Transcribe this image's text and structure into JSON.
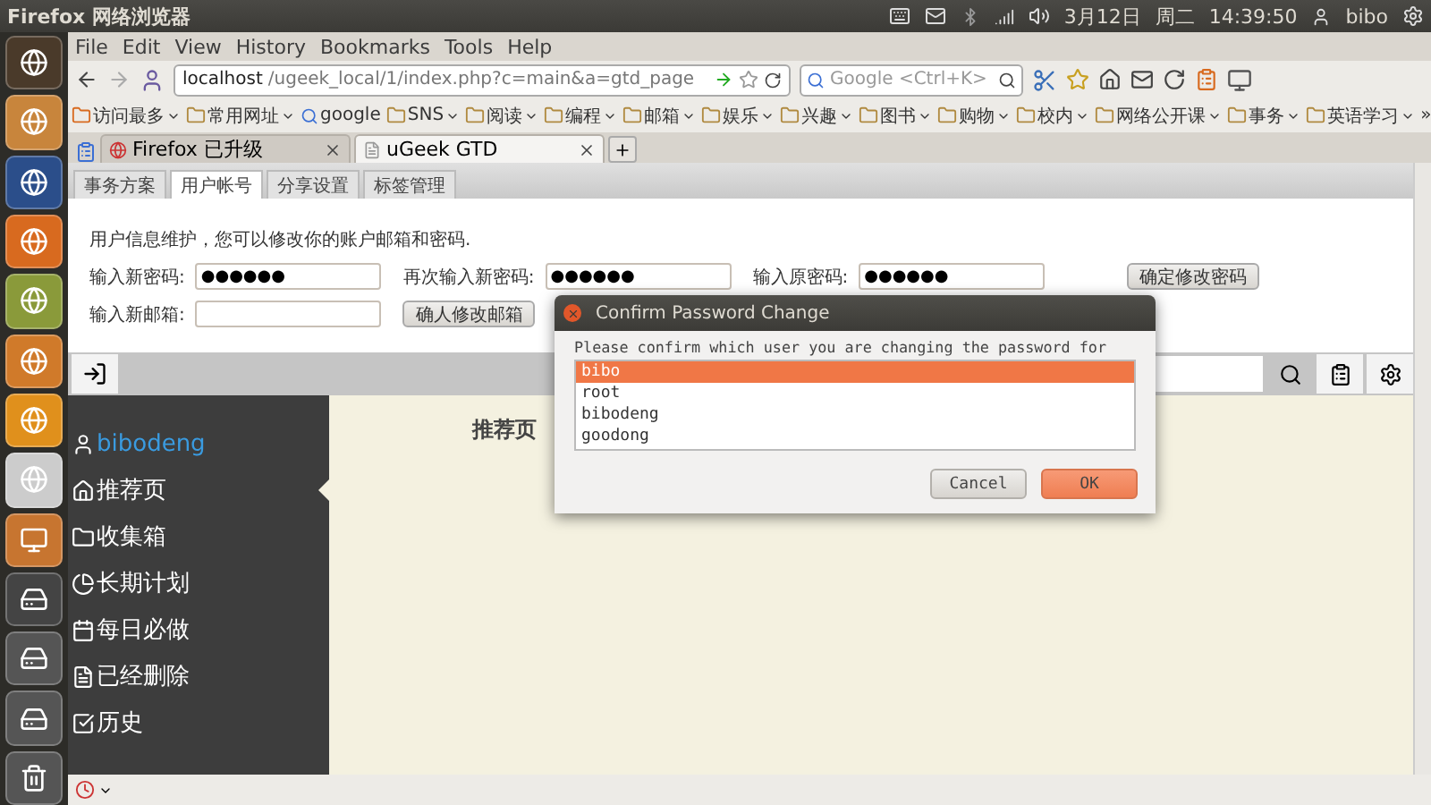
{
  "top_panel": {
    "app_title": "Firefox 网络浏览器",
    "date": "3月12日",
    "weekday": "周二",
    "time": "14:39:50",
    "user": "bibo"
  },
  "menu_bar": [
    "File",
    "Edit",
    "View",
    "History",
    "Bookmarks",
    "Tools",
    "Help"
  ],
  "nav_bar": {
    "url_host": "localhost",
    "url_path": "/ugeek_local/1/index.php?c=main&a=gtd_page",
    "search": {
      "placeholder": "Google <Ctrl+K>"
    }
  },
  "bookmarks": [
    {
      "label": "访问最多",
      "kind": "smart"
    },
    {
      "label": "常用网址",
      "kind": "folder"
    },
    {
      "label": "google",
      "kind": "site"
    },
    {
      "label": "SNS",
      "kind": "folder"
    },
    {
      "label": "阅读",
      "kind": "folder"
    },
    {
      "label": "编程",
      "kind": "folder"
    },
    {
      "label": "邮箱",
      "kind": "folder"
    },
    {
      "label": "娱乐",
      "kind": "folder"
    },
    {
      "label": "兴趣",
      "kind": "folder"
    },
    {
      "label": "图书",
      "kind": "folder"
    },
    {
      "label": "购物",
      "kind": "folder"
    },
    {
      "label": "校内",
      "kind": "folder"
    },
    {
      "label": "网络公开课",
      "kind": "folder"
    },
    {
      "label": "事务",
      "kind": "folder"
    },
    {
      "label": "英语学习",
      "kind": "folder"
    }
  ],
  "bookmarks_more": "»",
  "browser_tabs": [
    {
      "label": "Firefox 已升级",
      "selected": false
    },
    {
      "label": "uGeek GTD",
      "selected": true
    }
  ],
  "page": {
    "tabs": [
      {
        "label": "事务方案",
        "selected": false
      },
      {
        "label": "用户帐号",
        "selected": true
      },
      {
        "label": "分享设置",
        "selected": false
      },
      {
        "label": "标签管理",
        "selected": false
      }
    ],
    "intro": "用户信息维护，您可以修改你的账户邮箱和密码.",
    "password_fields": [
      {
        "label": "输入新密码:",
        "value": "●●●●●●"
      },
      {
        "label": "再次输入新密码:",
        "value": "●●●●●●"
      },
      {
        "label": "输入原密码:",
        "value": "●●●●●●"
      }
    ],
    "password_button": "确定修改密码",
    "email_field": {
      "label": "输入新邮箱:"
    },
    "email_button": "确人修改邮箱"
  },
  "sidebar": {
    "user": "bibodeng",
    "items": [
      {
        "label": "推荐页",
        "kind": "home",
        "selected": true
      },
      {
        "label": "收集箱",
        "kind": "inbox",
        "selected": false
      },
      {
        "label": "长期计划",
        "kind": "plan",
        "selected": false
      },
      {
        "label": "每日必做",
        "kind": "daily",
        "selected": false
      },
      {
        "label": "已经删除",
        "kind": "deleted",
        "selected": false
      },
      {
        "label": "历史",
        "kind": "history",
        "selected": false
      }
    ]
  },
  "main": {
    "heading": "推荐页"
  },
  "dialog": {
    "title": "Confirm Password Change",
    "prompt": "Please confirm which user you are changing the password for",
    "users": [
      {
        "name": "bibo",
        "selected": true
      },
      {
        "name": "root",
        "selected": false
      },
      {
        "name": "bibodeng",
        "selected": false
      },
      {
        "name": "goodong",
        "selected": false
      }
    ],
    "buttons": [
      {
        "label": "Cancel",
        "kind": "cancel"
      },
      {
        "label": "OK",
        "kind": "ok"
      }
    ]
  }
}
